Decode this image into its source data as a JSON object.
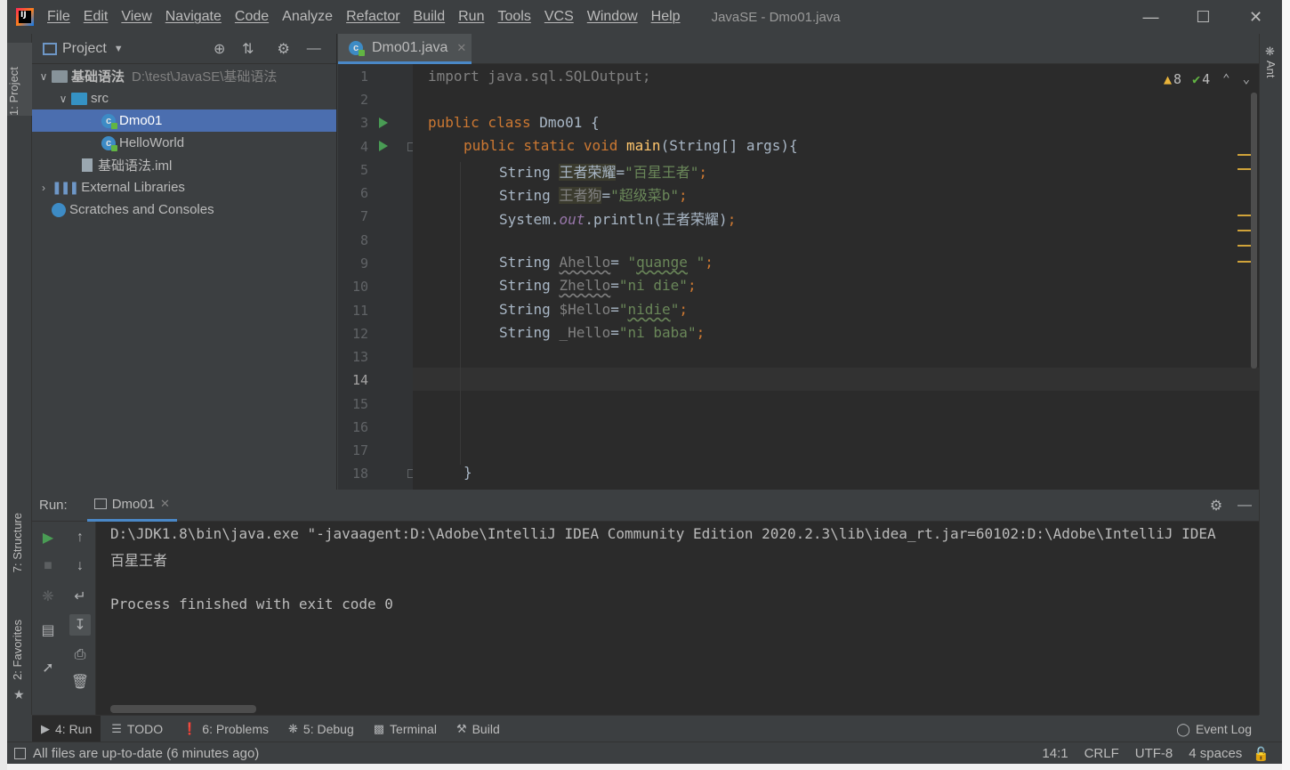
{
  "window": {
    "title": "JavaSE - Dmo01.java",
    "menu": [
      "File",
      "Edit",
      "View",
      "Navigate",
      "Code",
      "Analyze",
      "Refactor",
      "Build",
      "Run",
      "Tools",
      "VCS",
      "Window",
      "Help"
    ]
  },
  "left_stripe": {
    "project": "1: Project",
    "structure": "7: Structure",
    "favorites": "2: Favorites"
  },
  "right_stripe": {
    "ant": "Ant"
  },
  "project_panel": {
    "title": "Project",
    "tree": [
      {
        "label": "基础语法",
        "hint": "D:\\test\\JavaSE\\基础语法"
      },
      {
        "label": "src"
      },
      {
        "label": "Dmo01"
      },
      {
        "label": "HelloWorld"
      },
      {
        "label": "基础语法.iml"
      },
      {
        "label": "External Libraries"
      },
      {
        "label": "Scratches and Consoles"
      }
    ]
  },
  "editor": {
    "tab_label": "Dmo01.java",
    "inspection": {
      "warnings": "8",
      "weak_warnings": "4"
    },
    "line_numbers": [
      "1",
      "2",
      "3",
      "4",
      "5",
      "6",
      "7",
      "8",
      "9",
      "10",
      "11",
      "12",
      "13",
      "14",
      "15",
      "16",
      "17",
      "18"
    ],
    "current_line": "14",
    "code": {
      "l1": "import java.sql.SQLOutput;",
      "l3_kw": "public class",
      "l3_name": "Dmo01 {",
      "l4_kw": "public static void",
      "l4_fn": "main",
      "l4_rest": "(String[] args){",
      "l5_type": "String",
      "l5_var": "王者荣耀",
      "l5_eq": "=",
      "l5_str": "\"百星王者\"",
      "l5_end": ";",
      "l6_type": "String",
      "l6_var": "王者狗",
      "l6_eq": "=",
      "l6_str": "\"超级菜b\"",
      "l6_end": ";",
      "l7_a": "System.",
      "l7_field": "out",
      "l7_b": ".println(王者荣耀)",
      "l7_end": ";",
      "l9_type": "String",
      "l9_var": "Ahello",
      "l9_eq": "= ",
      "l9_q1": "\"",
      "l9_word": "quange",
      "l9_q2": " \"",
      "l9_end": ";",
      "l10_type": "String",
      "l10_var": "Zhello",
      "l10_eq": "=",
      "l10_str": "\"ni die\"",
      "l10_end": ";",
      "l11_type": "String",
      "l11_var": "$Hello",
      "l11_eq": "=",
      "l11_q1": "\"",
      "l11_word": "nidie",
      "l11_q2": "\"",
      "l11_end": ";",
      "l12_type": "String",
      "l12_var": "_Hello",
      "l12_eq": "=",
      "l12_str": "\"ni baba\"",
      "l12_end": ";",
      "l18": "}"
    }
  },
  "run_panel": {
    "title": "Run:",
    "tab_label": "Dmo01",
    "console": [
      "D:\\JDK1.8\\bin\\java.exe \"-javaagent:D:\\Adobe\\IntelliJ IDEA Community Edition 2020.2.3\\lib\\idea_rt.jar=60102:D:\\Adobe\\IntelliJ IDEA",
      "百星王者",
      "",
      "Process finished with exit code 0"
    ]
  },
  "tool_tabs": {
    "run": "4: Run",
    "todo": "TODO",
    "problems": "6: Problems",
    "debug": "5: Debug",
    "terminal": "Terminal",
    "build": "Build",
    "event_log": "Event Log"
  },
  "status_bar": {
    "message": "All files are up-to-date (6 minutes ago)",
    "position": "14:1",
    "line_sep": "CRLF",
    "encoding": "UTF-8",
    "indent": "4 spaces"
  },
  "colors": {
    "accent": "#4a88c7",
    "keyword": "#cc7832",
    "string": "#6a8759",
    "function": "#ffc66d",
    "warning": "#e8b33a",
    "run_green": "#499c54"
  }
}
